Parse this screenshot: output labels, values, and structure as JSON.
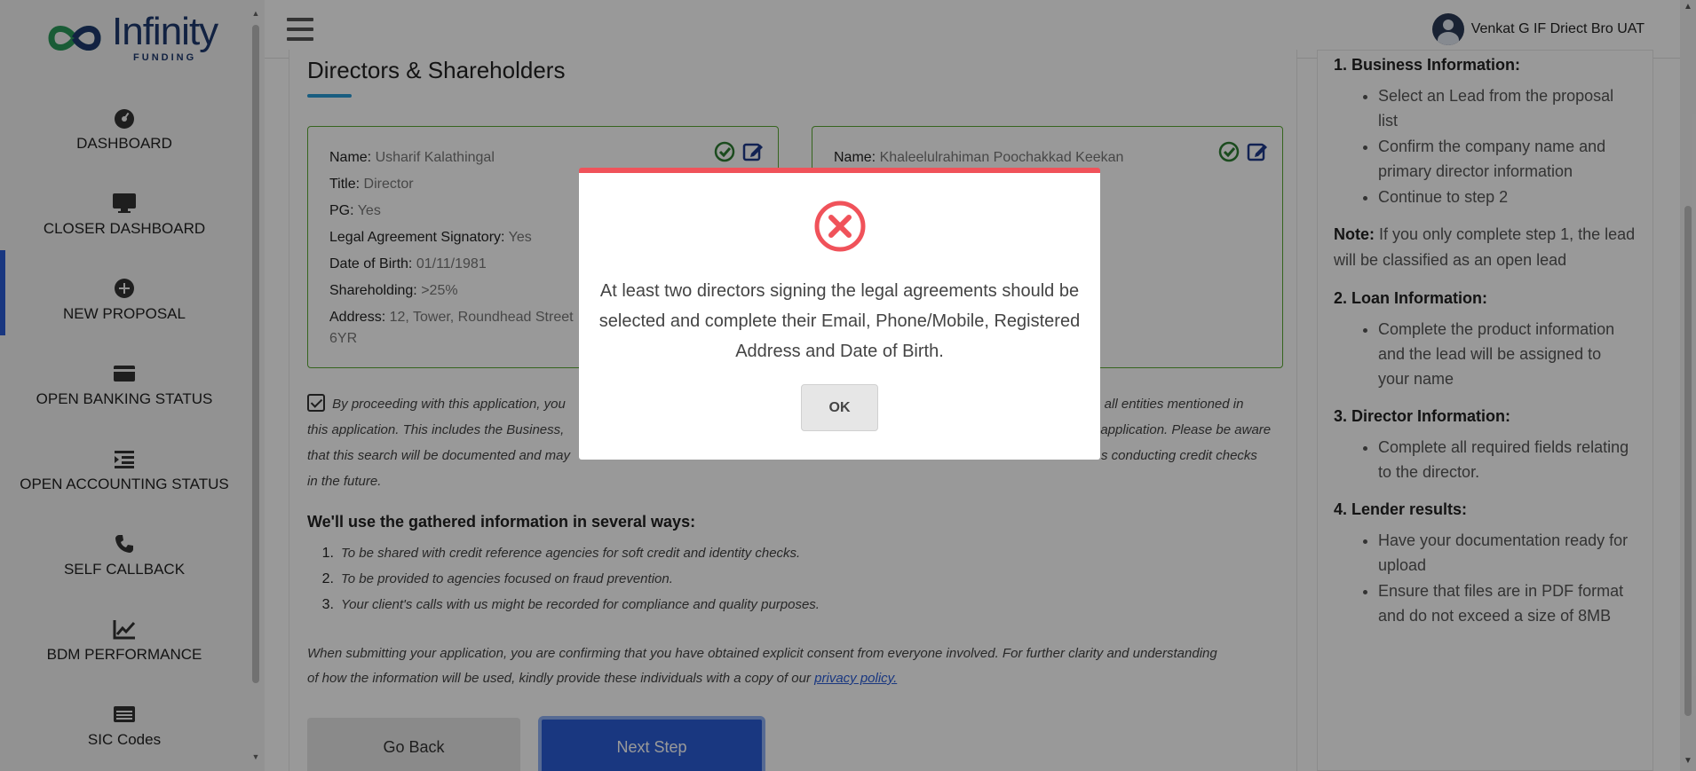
{
  "app": {
    "logo_main": "Infinity",
    "logo_sub": "FUNDING"
  },
  "sidebar": {
    "items": [
      {
        "label": "DASHBOARD",
        "icon": "dashboard-gauge-icon"
      },
      {
        "label": "CLOSER DASHBOARD",
        "icon": "monitor-icon"
      },
      {
        "label": "NEW PROPOSAL",
        "icon": "plus-circle-icon"
      },
      {
        "label": "OPEN BANKING STATUS",
        "icon": "card-icon"
      },
      {
        "label": "OPEN ACCOUNTING STATUS",
        "icon": "indent-list-icon"
      },
      {
        "label": "SELF CALLBACK",
        "icon": "phone-icon"
      },
      {
        "label": "BDM PERFORMANCE",
        "icon": "line-chart-icon"
      },
      {
        "label": "SIC Codes",
        "icon": "list-card-icon"
      }
    ],
    "active_index": 2
  },
  "topbar": {
    "user_name": "Venkat G IF Driect Bro UAT"
  },
  "main": {
    "section_title": "Directors & Shareholders",
    "directors": [
      {
        "name_label": "Name:",
        "name": "Usharif Kalathingal",
        "title_label": "Title:",
        "title": "Director",
        "pg_label": "PG:",
        "pg": "Yes",
        "signatory_label": "Legal Agreement Signatory:",
        "signatory": "Yes",
        "dob_label": "Date of Birth:",
        "dob": "01/11/1981",
        "shareholding_label": "Shareholding:",
        "shareholding": ">25%",
        "address_label": "Address:",
        "address": "12, Tower, Roundhead Street",
        "address_line2": "6YR"
      },
      {
        "name_label": "Name:",
        "name": "Khaleelulrahiman Poochakkad Keekan"
      }
    ],
    "consent_line1": "By proceeding with this application, you",
    "consent_line1_end": "on all entities mentioned in",
    "consent_line2": "this application. This includes the Business,",
    "consent_line2_end": "application. Please be aware",
    "consent_line3": "that this search will be documented and may",
    "consent_line3_end": "s conducting credit checks",
    "consent_line4": "in the future.",
    "uses_heading": "We'll use the gathered information in several ways:",
    "uses": [
      {
        "num": "1.",
        "text": "To be shared with credit reference agencies for soft credit and identity checks."
      },
      {
        "num": "2.",
        "text": "To be provided to agencies focused on fraud prevention."
      },
      {
        "num": "3.",
        "text": "Your client's calls with us might be recorded for compliance and quality purposes."
      }
    ],
    "footer_line1": "When submitting your application, you are confirming that you have obtained explicit consent from everyone involved. For further clarity and understanding",
    "footer_line2": "of how the information will be used, kindly provide these individuals with a copy of our",
    "privacy_link": "privacy policy.",
    "back_label": "Go Back",
    "next_label": "Next Step"
  },
  "help": {
    "s1_title": "1. Business Information:",
    "s1_items": [
      "Select an Lead from the proposal list",
      "Confirm the company name and primary director information",
      "Continue to step 2"
    ],
    "note_label": "Note:",
    "note_text": " If you only complete step 1, the lead will be classified as an open lead",
    "s2_title": "2. Loan Information:",
    "s2_items": [
      "Complete the product information and the lead will be assigned to your name"
    ],
    "s3_title": "3. Director Information:",
    "s3_items": [
      "Complete all required fields relating to the director."
    ],
    "s4_title": "4. Lender results:",
    "s4_items": [
      "Have your documentation ready for upload",
      "Ensure that files are in PDF format and do not exceed a size of 8MB"
    ]
  },
  "modal": {
    "message": "At least two directors signing the legal agreements should be selected and complete their Email, Phone/Mobile, Registered Address and Date of Birth.",
    "ok_label": "OK",
    "icon": "error-x-circle-icon",
    "accent_color": "#f0525a"
  }
}
